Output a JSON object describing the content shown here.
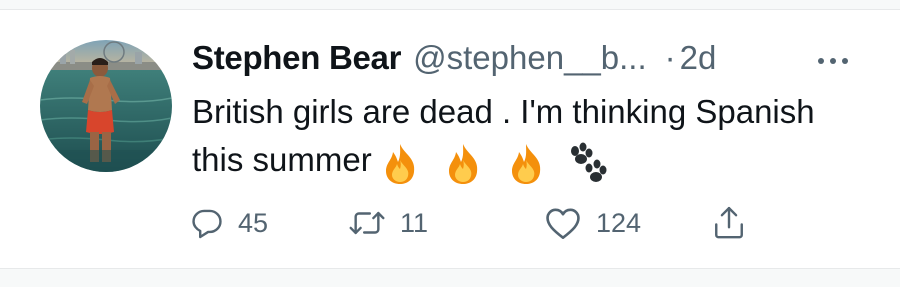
{
  "tweet": {
    "display_name": "Stephen Bear",
    "handle": "@stephen__b...",
    "separator": "·",
    "time": "2d",
    "text": "British girls are dead . I'm thinking Spanish this summer",
    "emojis": [
      "fire-emoji",
      "fire-emoji",
      "fire-emoji",
      "paw-prints-emoji"
    ]
  },
  "actions": {
    "replies": "45",
    "retweets": "11",
    "likes": "124"
  },
  "icons": {
    "reply": "reply-icon",
    "retweet": "retweet-icon",
    "like": "heart-icon",
    "share": "share-icon",
    "more": "more-icon"
  },
  "colors": {
    "text": "#0f1419",
    "secondary": "#536471",
    "divider_bg": "#f7f9f9"
  }
}
